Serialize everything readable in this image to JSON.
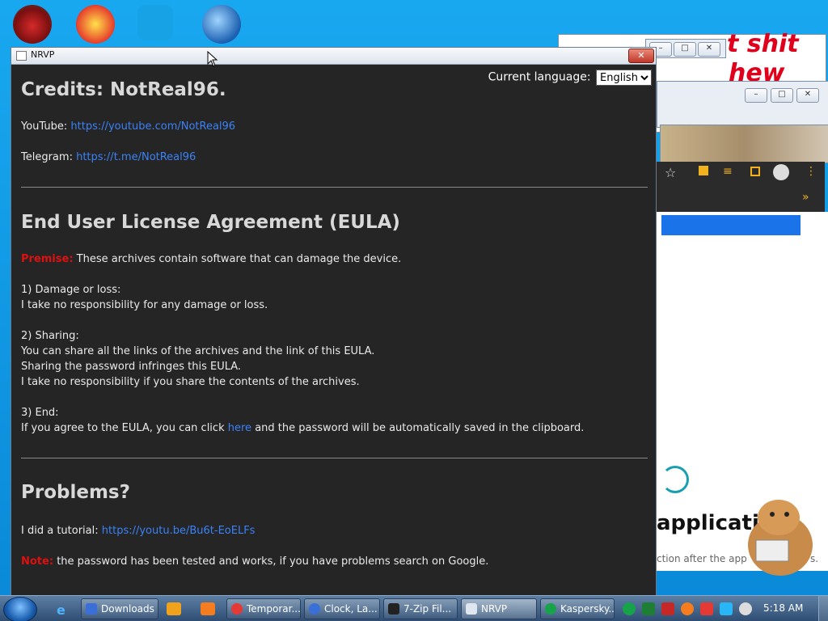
{
  "window": {
    "title": "NRVP",
    "close_label": "✕"
  },
  "language": {
    "label": "Current language:",
    "selected": "English",
    "options": [
      "English"
    ]
  },
  "credits": {
    "heading": "Credits: NotReal96.",
    "youtube_label": "YouTube:",
    "youtube_link": "https://youtube.com/NotReal96",
    "telegram_label": "Telegram:",
    "telegram_link": "https://t.me/NotReal96"
  },
  "eula": {
    "heading": "End User License Agreement (EULA)",
    "premise_label": "Premise:",
    "premise_text": "These archives contain software that can damage the device.",
    "s1_title": "1) Damage or loss:",
    "s1_text": "I take no responsibility for any damage or loss.",
    "s2_title": "2) Sharing:",
    "s2_line1": "You can share all the links of the archives and the link of this EULA.",
    "s2_line2": "Sharing the password infringes this EULA.",
    "s2_line3": "I take no responsibility if you share the contents of the archives.",
    "s3_title": "3) End:",
    "s3_before": "If you agree to the EULA, you can click",
    "s3_link": "here",
    "s3_after": "and the password will be automatically saved in the clipboard."
  },
  "problems": {
    "heading": "Problems?",
    "tutorial_label": "I did a tutorial:",
    "tutorial_link": "https://youtu.be/Bu6t-EoELFs",
    "note_label": "Note:",
    "note_text": "the password has been tested and works, if you have problems search on Google."
  },
  "background": {
    "paint_text_1": "t shit",
    "paint_text_2": "hew",
    "app_text": "application",
    "app_sub": "ction after the app",
    "app_sub_end": "s."
  },
  "taskbar": {
    "items": [
      {
        "label": "Downloads",
        "color": "#3a6fd8"
      },
      {
        "label": "Temporar...",
        "color": "#e53935"
      },
      {
        "label": "Clock, La...",
        "color": "#3a6fd8"
      },
      {
        "label": "7-Zip Fil...",
        "color": "#222222"
      },
      {
        "label": "NRVP",
        "color": "#dfe6ef"
      },
      {
        "label": "Kaspersky...",
        "color": "#16a34a"
      }
    ],
    "clock": "5:18 AM"
  }
}
